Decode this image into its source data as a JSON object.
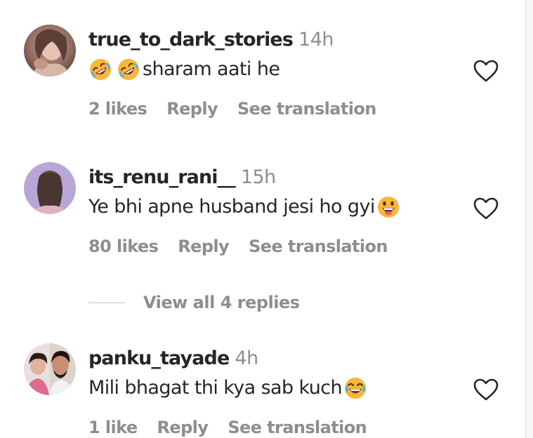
{
  "comments": [
    {
      "username": "true_to_dark_stories",
      "time": "14h",
      "text": "sharam aati he",
      "leading_emojis": [
        "rolling-on-floor-laughing",
        "rolling-on-floor-laughing"
      ],
      "likes": "2 likes",
      "reply_label": "Reply",
      "translate_label": "See translation"
    },
    {
      "username": "its_renu_rani__",
      "time": "15h",
      "text": "Ye bhi apne husband jesi ho gyi",
      "trailing_emoji": "grinning-face",
      "likes": "80 likes",
      "reply_label": "Reply",
      "translate_label": "See translation",
      "view_replies_label": "View all 4 replies"
    },
    {
      "username": "panku_tayade",
      "time": "4h",
      "text": "Mili bhagat thi kya sab kuch",
      "trailing_emoji": "face-with-tears-of-joy",
      "likes": "1 like",
      "reply_label": "Reply",
      "translate_label": "See translation"
    }
  ],
  "colors": {
    "primary_text": "#262626",
    "secondary_text": "#8e8e8e",
    "emoji_yellow": "#f7b83a"
  }
}
